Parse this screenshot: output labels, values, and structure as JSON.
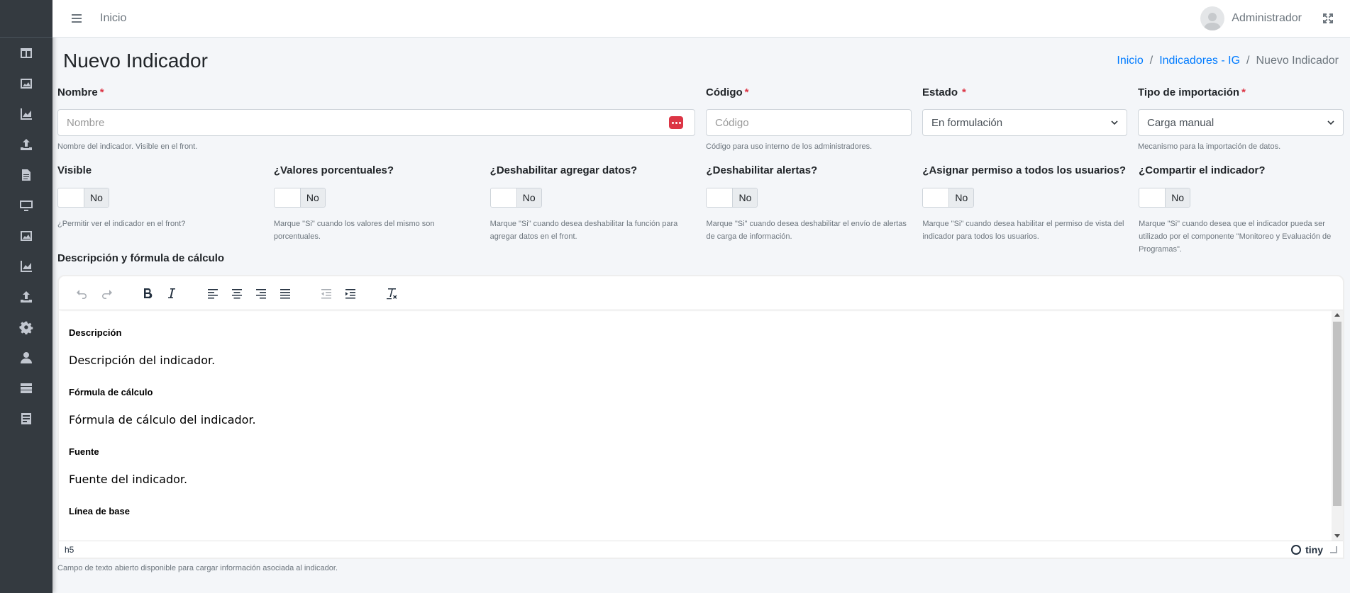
{
  "navbar": {
    "home_link": "Inicio",
    "user_name": "Administrador"
  },
  "sidebar": {
    "items": [
      {
        "icon": "table-columns-icon"
      },
      {
        "icon": "image-icon"
      },
      {
        "icon": "area-chart-icon"
      },
      {
        "icon": "upload-icon"
      },
      {
        "icon": "file-icon"
      },
      {
        "icon": "desktop-icon"
      },
      {
        "icon": "image-icon"
      },
      {
        "icon": "area-chart-icon"
      },
      {
        "icon": "upload-icon"
      },
      {
        "icon": "gear-icon"
      },
      {
        "icon": "user-icon"
      },
      {
        "icon": "server-icon"
      },
      {
        "icon": "document-icon"
      }
    ]
  },
  "page": {
    "title": "Nuevo Indicador",
    "breadcrumb": [
      "Inicio",
      "Indicadores - IG",
      "Nuevo Indicador"
    ]
  },
  "form": {
    "nombre": {
      "label": "Nombre",
      "required": "*",
      "placeholder": "Nombre",
      "help": "Nombre del indicador. Visible en el front."
    },
    "codigo": {
      "label": "Código",
      "required": "*",
      "placeholder": "Código",
      "help": "Código para uso interno de los administradores."
    },
    "estado": {
      "label": "Estado",
      "required": "*",
      "value": "En formulación"
    },
    "tipo_importacion": {
      "label": "Tipo de importación",
      "required": "*",
      "value": "Carga manual",
      "help": "Mecanismo para la importación de datos."
    },
    "toggles": [
      {
        "label": "Visible",
        "state": "No",
        "help": "¿Permitir ver el indicador en el front?"
      },
      {
        "label": "¿Valores porcentuales?",
        "state": "No",
        "help": "Marque \"Si\" cuando los valores del mismo son porcentuales."
      },
      {
        "label": "¿Deshabilitar agregar datos?",
        "state": "No",
        "help": "Marque \"Si\" cuando desea deshabilitar la función para agregar datos en el front."
      },
      {
        "label": "¿Deshabilitar alertas?",
        "state": "No",
        "help": "Marque \"Si\" cuando desea deshabilitar el envío de alertas de carga de información."
      },
      {
        "label": "¿Asignar permiso a todos los usuarios?",
        "state": "No",
        "help": "Marque \"Si\" cuando desea habilitar el permiso de vista del indicador para todos los usuarios."
      },
      {
        "label": "¿Compartir el indicador?",
        "state": "No",
        "help": "Marque \"Si\" cuando desea que el indicador pueda ser utilizado por el componente \"Monitoreo y Evaluación de Programas\"."
      }
    ],
    "editor": {
      "label": "Descripción y fórmula de cálculo",
      "content": [
        {
          "heading": "Descripción",
          "text": "Descripción del indicador."
        },
        {
          "heading": "Fórmula de cálculo",
          "text": "Fórmula de cálculo del indicador."
        },
        {
          "heading": "Fuente",
          "text": "Fuente del indicador."
        },
        {
          "heading": "Línea de base",
          "text": ""
        }
      ],
      "status_path": "h5",
      "brand": "tiny",
      "help": "Campo de texto abierto disponible para cargar información asociada al indicador."
    }
  }
}
